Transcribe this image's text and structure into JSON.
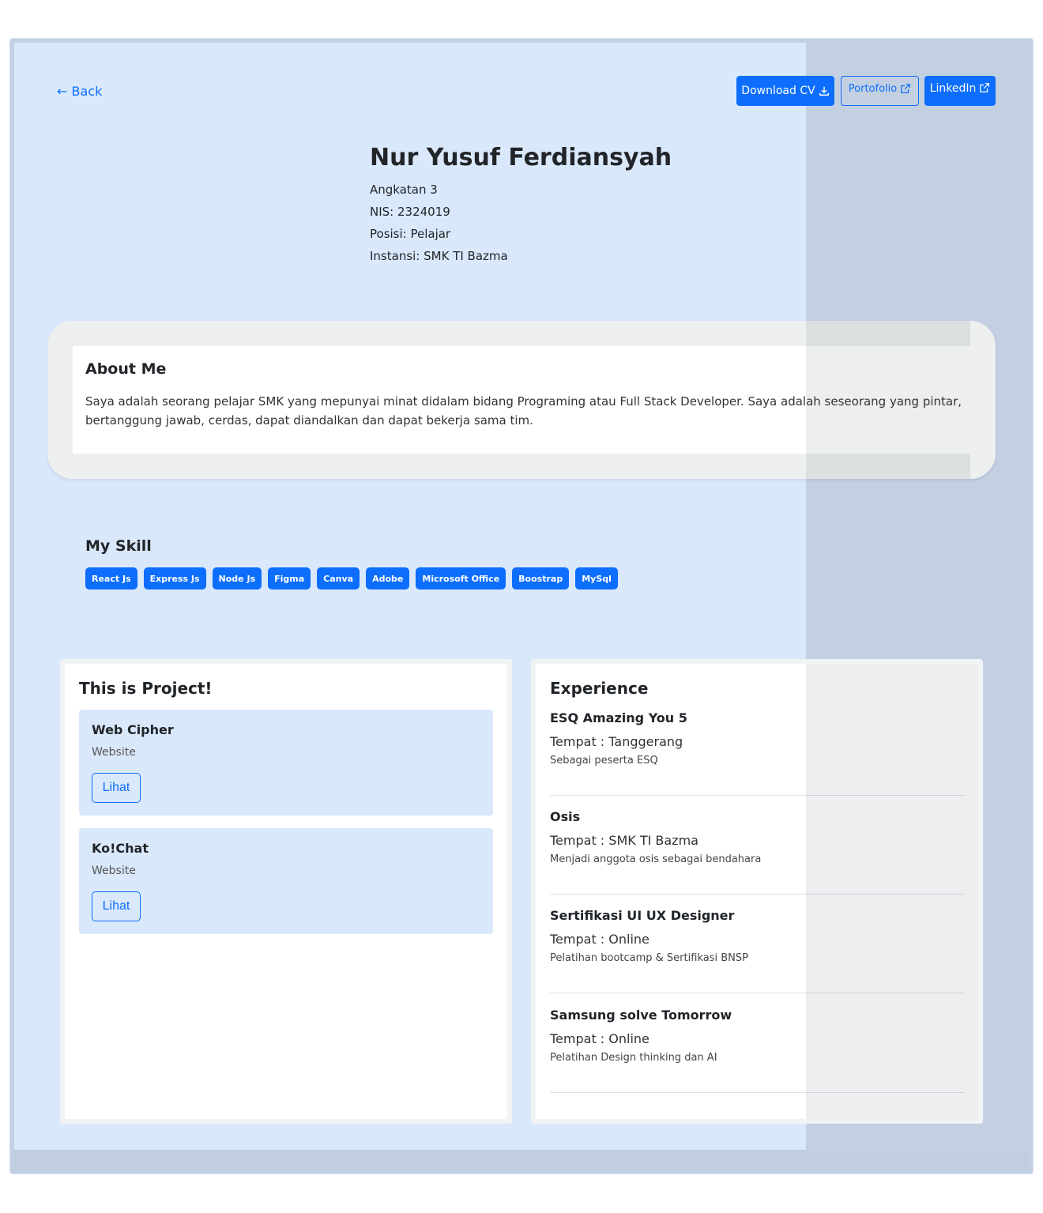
{
  "nav": {
    "back_label": "← Back"
  },
  "actions": {
    "download_cv": "Download CV",
    "portfolio": "Portofolio",
    "linkedin": "LinkedIn"
  },
  "profile": {
    "name": "Nur Yusuf Ferdiansyah",
    "angkatan": "Angkatan 3",
    "nis": "NIS: 2324019",
    "posisi": "Posisi: Pelajar",
    "instansi": "Instansi: SMK TI Bazma"
  },
  "about": {
    "title": "About Me",
    "text": "Saya adalah seorang pelajar SMK yang mepunyai minat didalam bidang Programing atau Full Stack Developer. Saya adalah seseorang yang pintar, bertanggung jawab, cerdas, dapat diandalkan dan dapat bekerja sama tim."
  },
  "skills": {
    "title": "My Skill",
    "items": [
      "React Js",
      "Express Js",
      "Node Js",
      "Figma",
      "Canva",
      "Adobe",
      "Microsoft Office",
      "Boostrap",
      "MySql"
    ]
  },
  "projects": {
    "title": "This is Project!",
    "items": [
      {
        "name": "Web Cipher",
        "type": "Website",
        "button": "Lihat"
      },
      {
        "name": "Ko!Chat",
        "type": "Website",
        "button": "Lihat"
      }
    ]
  },
  "experience": {
    "title": "Experience",
    "items": [
      {
        "name": "ESQ Amazing You 5",
        "place": "Tempat : Tanggerang",
        "desc": "Sebagai peserta ESQ"
      },
      {
        "name": "Osis",
        "place": "Tempat : SMK TI Bazma",
        "desc": "Menjadi anggota osis sebagai bendahara"
      },
      {
        "name": "Sertifikasi UI UX Designer",
        "place": "Tempat : Online",
        "desc": "Pelatihan bootcamp & Sertifikasi BNSP"
      },
      {
        "name": "Samsung solve Tomorrow",
        "place": "Tempat : Online",
        "desc": "Pelatihan Design thinking dan AI"
      }
    ]
  },
  "colors": {
    "primary": "#0d6efd",
    "page_bg": "#dae8fc",
    "frame_bg": "#c3d0e2"
  }
}
